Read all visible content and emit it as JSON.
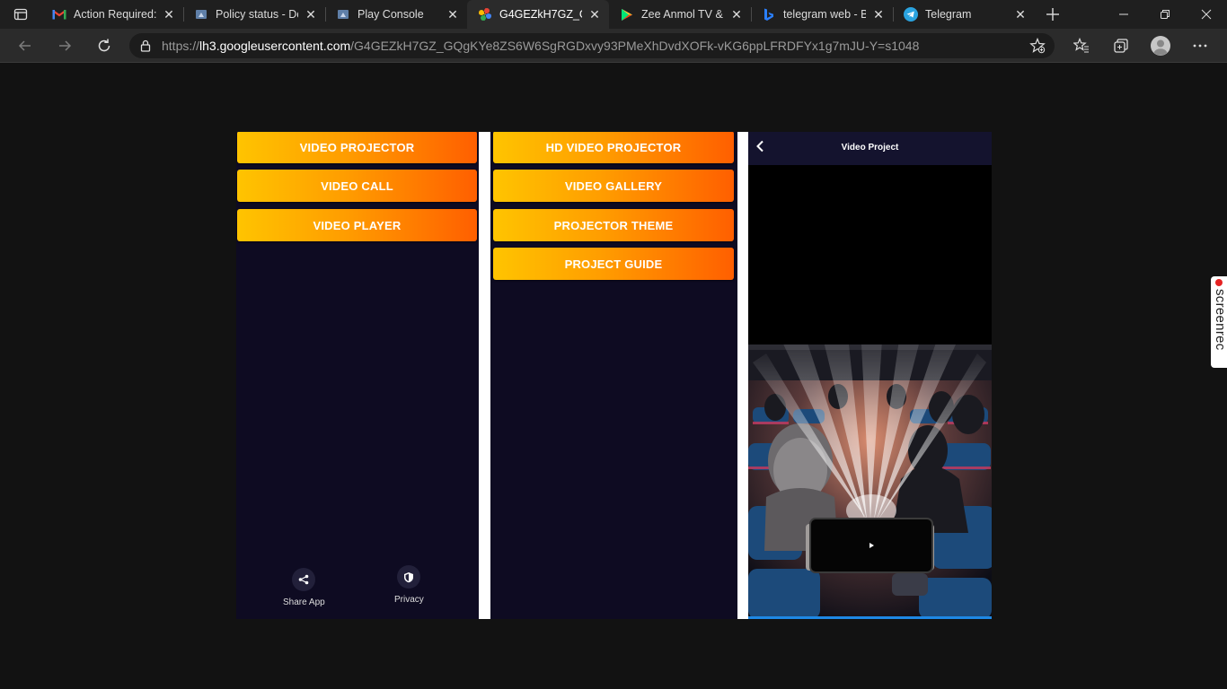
{
  "browser": {
    "tabs": [
      {
        "title": "Action Required:",
        "icon": "gmail-icon",
        "active": false
      },
      {
        "title": "Policy status - De",
        "icon": "play-console-icon",
        "active": false
      },
      {
        "title": "Play Console",
        "icon": "play-console-icon",
        "active": false
      },
      {
        "title": "G4GEZkH7GZ_GC",
        "icon": "google-photos-icon",
        "active": true
      },
      {
        "title": "Zee Anmol TV &",
        "icon": "google-play-icon",
        "active": false
      },
      {
        "title": "telegram web - B",
        "icon": "bing-icon",
        "active": false
      },
      {
        "title": "Telegram",
        "icon": "telegram-icon",
        "active": false
      }
    ],
    "address": {
      "prefix": "https://",
      "host": "lh3.googleusercontent.com",
      "path": "/G4GEZkH7GZ_GQgKYe8ZS6W6SgRGDxvy93PMeXhDvdXOFk-vKG6ppLFRDFYx1g7mJU-Y=s1048"
    }
  },
  "screens": {
    "screen1": {
      "buttons": [
        "VIDEO PROJECTOR",
        "VIDEO CALL",
        "VIDEO PLAYER"
      ],
      "footer": {
        "share": "Share App",
        "privacy": "Privacy"
      }
    },
    "screen2": {
      "buttons": [
        "HD VIDEO PROJECTOR",
        "VIDEO GALLERY",
        "PROJECTOR THEME",
        "PROJECT GUIDE"
      ]
    },
    "screen3": {
      "title": "Video Project"
    }
  },
  "overlay": {
    "screenrec_label": "screenrec"
  },
  "colors": {
    "button_gradient_start": "#ffc400",
    "button_gradient_end": "#ff5f00",
    "app_background": "#0e0b22",
    "header_background": "#14132e"
  }
}
